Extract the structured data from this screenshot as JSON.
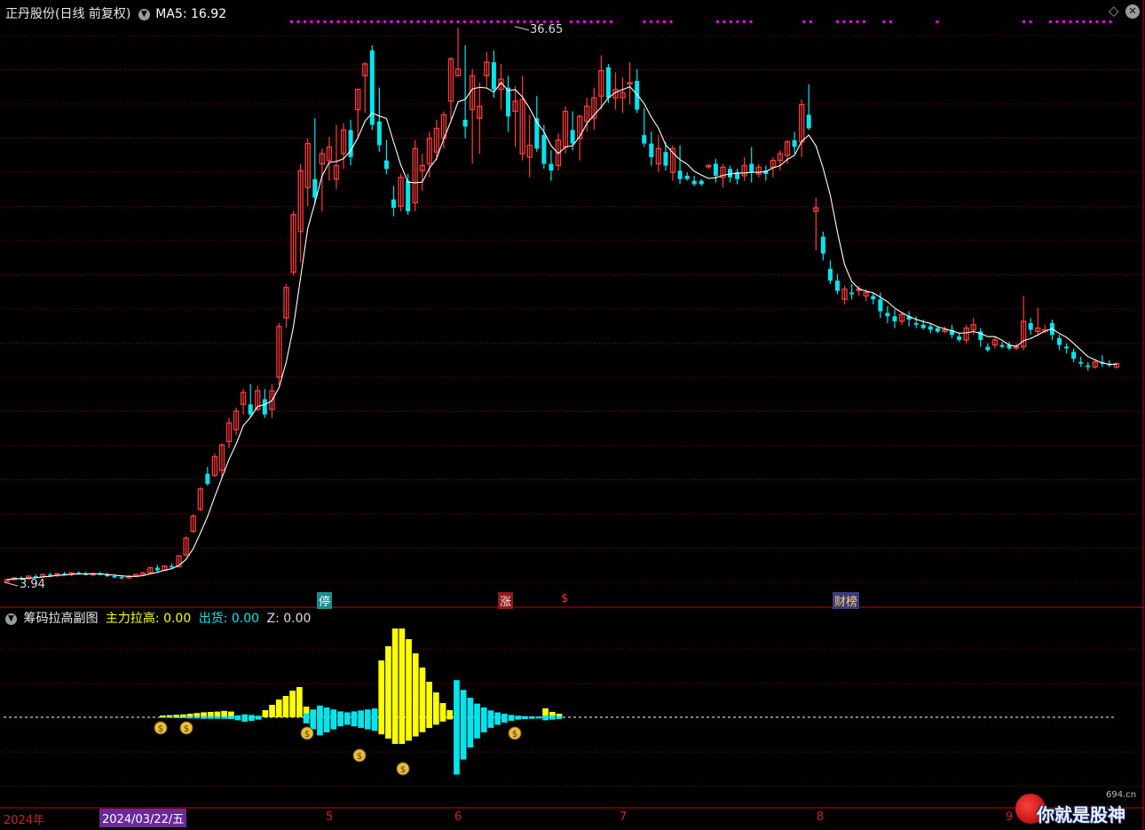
{
  "main_header": {
    "title": "正丹股份(日线 前复权)",
    "ma_label": "MA5:",
    "ma_value": "16.92"
  },
  "sub_header": {
    "title": "筹码拉高副图",
    "zl_label": "主力拉高:",
    "zl_value": "0.00",
    "ch_label": "出货:",
    "ch_value": "0.00",
    "z_label": "Z:",
    "z_value": "0.00"
  },
  "markers": [
    {
      "text": "停",
      "color": "#1c8c8c",
      "fg": "#e0ffff"
    },
    {
      "text": "涨",
      "color": "#8c1c1c",
      "fg": "#ffe0e0"
    },
    {
      "text": "$",
      "color": "#000000",
      "fg": "#ff3030"
    },
    {
      "text": "财榜",
      "color": "#3c3c7c",
      "fg": "#ffd070"
    }
  ],
  "time_axis": {
    "year_label": "2024年",
    "cursor_date": "2024/03/22/五",
    "months": [
      "5",
      "6",
      "7",
      "8",
      "9"
    ]
  },
  "watermark": {
    "text": "你就是股神",
    "site": "694.cn"
  },
  "colors": {
    "up": "#ff3b3b",
    "down": "#00e5ee",
    "ma": "#ffffff",
    "zhuli": "#ffff00",
    "chuhuo": "#00e5ee",
    "grid": "#6b0000",
    "magenta": "#ff00ff"
  },
  "chart_data": {
    "type": "candlestick",
    "price_annotations": {
      "high": "36.65",
      "low": "3.94"
    },
    "candles": [
      [
        3.94,
        4.1,
        3.9,
        4.05
      ],
      [
        4.05,
        4.2,
        4.0,
        4.15
      ],
      [
        4.15,
        4.25,
        4.05,
        4.1
      ],
      [
        4.1,
        4.3,
        4.05,
        4.25
      ],
      [
        4.25,
        4.35,
        4.15,
        4.2
      ],
      [
        4.2,
        4.4,
        4.15,
        4.35
      ],
      [
        4.35,
        4.45,
        4.25,
        4.3
      ],
      [
        4.3,
        4.45,
        4.2,
        4.4
      ],
      [
        4.4,
        4.5,
        4.3,
        4.35
      ],
      [
        4.35,
        4.5,
        4.25,
        4.45
      ],
      [
        4.45,
        4.55,
        4.35,
        4.4
      ],
      [
        4.4,
        4.5,
        4.3,
        4.35
      ],
      [
        4.35,
        4.45,
        4.25,
        4.4
      ],
      [
        4.4,
        4.5,
        4.3,
        4.35
      ],
      [
        4.35,
        4.45,
        4.2,
        4.25
      ],
      [
        4.25,
        4.35,
        4.15,
        4.2
      ],
      [
        4.2,
        4.3,
        4.1,
        4.15
      ],
      [
        4.15,
        4.3,
        4.1,
        4.25
      ],
      [
        4.25,
        4.4,
        4.2,
        4.35
      ],
      [
        4.35,
        4.5,
        4.3,
        4.45
      ],
      [
        4.45,
        4.8,
        4.4,
        4.75
      ],
      [
        4.75,
        4.9,
        4.5,
        4.6
      ],
      [
        4.6,
        4.9,
        4.55,
        4.85
      ],
      [
        4.85,
        5.0,
        4.7,
        4.8
      ],
      [
        4.8,
        5.5,
        4.8,
        5.45
      ],
      [
        5.5,
        6.6,
        5.4,
        6.5
      ],
      [
        6.9,
        7.9,
        6.8,
        7.8
      ],
      [
        8.2,
        9.5,
        8.1,
        9.4
      ],
      [
        10.3,
        10.7,
        9.6,
        9.7
      ],
      [
        10.2,
        11.5,
        10.1,
        11.3
      ],
      [
        10.5,
        12.1,
        10.1,
        12.0
      ],
      [
        12.2,
        13.6,
        11.8,
        13.3
      ],
      [
        12.9,
        14.2,
        12.6,
        14.0
      ],
      [
        14.4,
        15.3,
        13.8,
        15.1
      ],
      [
        14.4,
        15.6,
        13.6,
        13.8
      ],
      [
        14.1,
        15.5,
        14.0,
        15.2
      ],
      [
        14.7,
        15.3,
        13.6,
        13.8
      ],
      [
        14.1,
        15.6,
        13.6,
        15.2
      ],
      [
        16.0,
        19.2,
        15.5,
        19.0
      ],
      [
        19.5,
        21.5,
        18.9,
        21.3
      ],
      [
        22.2,
        25.8,
        22.0,
        25.6
      ],
      [
        24.6,
        28.6,
        22.8,
        28.2
      ],
      [
        27.2,
        30.1,
        26.1,
        29.8
      ],
      [
        27.7,
        31.3,
        26.2,
        26.6
      ],
      [
        28.6,
        29.5,
        25.8,
        29.2
      ],
      [
        28.8,
        30.2,
        27.6,
        29.6
      ],
      [
        27.7,
        30.9,
        27.1,
        28.5
      ],
      [
        29.2,
        31.0,
        28.3,
        30.6
      ],
      [
        30.6,
        31.2,
        28.5,
        29.0
      ],
      [
        31.8,
        33.0,
        30.2,
        33.0
      ],
      [
        33.8,
        34.6,
        31.6,
        34.5
      ],
      [
        35.3,
        35.6,
        30.6,
        30.9
      ],
      [
        31.1,
        33.1,
        29.3,
        29.7
      ],
      [
        28.8,
        30.0,
        28.0,
        28.3
      ],
      [
        26.5,
        27.3,
        25.5,
        26.0
      ],
      [
        26.1,
        28.0,
        25.8,
        27.8
      ],
      [
        27.6,
        28.0,
        25.6,
        25.8
      ],
      [
        26.3,
        30.0,
        25.8,
        29.5
      ],
      [
        28.2,
        29.2,
        27.0,
        28.5
      ],
      [
        28.6,
        30.5,
        27.8,
        30.1
      ],
      [
        29.3,
        31.2,
        28.8,
        30.7
      ],
      [
        30.1,
        31.7,
        29.5,
        31.5
      ],
      [
        32.3,
        34.9,
        31.2,
        34.8
      ],
      [
        33.8,
        36.65,
        33.8,
        34.2
      ],
      [
        31.2,
        35.6,
        30.1,
        30.8
      ],
      [
        31.8,
        34.2,
        28.6,
        33.8
      ],
      [
        31.3,
        33.4,
        29.2,
        32.0
      ],
      [
        33.8,
        35.2,
        33.1,
        34.6
      ],
      [
        34.6,
        35.3,
        32.5,
        33.0
      ],
      [
        33.0,
        34.5,
        31.8,
        33.6
      ],
      [
        33.1,
        33.8,
        30.5,
        31.4
      ],
      [
        31.7,
        33.2,
        29.6,
        32.3
      ],
      [
        29.2,
        33.8,
        28.8,
        32.4
      ],
      [
        29.0,
        31.5,
        27.8,
        29.7
      ],
      [
        31.3,
        32.6,
        29.3,
        29.5
      ],
      [
        30.3,
        30.9,
        28.3,
        28.6
      ],
      [
        28.6,
        29.4,
        27.6,
        28.2
      ],
      [
        28.5,
        30.4,
        28.2,
        30.0
      ],
      [
        29.6,
        32.0,
        29.2,
        31.7
      ],
      [
        30.6,
        31.7,
        29.4,
        29.8
      ],
      [
        30.1,
        31.5,
        28.8,
        31.4
      ],
      [
        31.1,
        32.5,
        30.5,
        32.0
      ],
      [
        31.3,
        33.1,
        30.6,
        32.5
      ],
      [
        32.6,
        35.0,
        31.8,
        34.1
      ],
      [
        34.3,
        34.5,
        32.2,
        32.5
      ],
      [
        32.5,
        34.0,
        31.8,
        33.0
      ],
      [
        32.5,
        33.7,
        31.6,
        32.8
      ],
      [
        33.4,
        34.6,
        32.1,
        33.4
      ],
      [
        33.5,
        34.2,
        31.6,
        31.8
      ],
      [
        30.3,
        31.9,
        29.6,
        29.8
      ],
      [
        29.8,
        30.5,
        28.5,
        29.0
      ],
      [
        28.6,
        30.3,
        28.1,
        29.5
      ],
      [
        29.3,
        29.9,
        28.2,
        28.5
      ],
      [
        28.1,
        29.7,
        27.6,
        29.5
      ],
      [
        28.2,
        29.7,
        27.4,
        27.7
      ],
      [
        27.9,
        28.1,
        27.6,
        27.7
      ],
      [
        27.6,
        27.9,
        27.3,
        27.4
      ],
      [
        27.6,
        27.7,
        27.3,
        27.4
      ],
      [
        28.5,
        28.6,
        28.3,
        28.5
      ],
      [
        28.6,
        28.9,
        27.5,
        27.9
      ],
      [
        27.8,
        28.6,
        27.2,
        28.4
      ],
      [
        28.3,
        28.5,
        27.5,
        27.8
      ],
      [
        28.1,
        28.3,
        27.4,
        27.7
      ],
      [
        27.9,
        29.0,
        27.6,
        28.5
      ],
      [
        28.6,
        29.6,
        27.5,
        28.1
      ],
      [
        28.0,
        28.6,
        27.8,
        28.4
      ],
      [
        28.2,
        28.5,
        27.6,
        28.0
      ],
      [
        28.4,
        29.0,
        27.8,
        28.8
      ],
      [
        28.8,
        29.4,
        28.2,
        29.2
      ],
      [
        29.1,
        30.0,
        28.6,
        29.9
      ],
      [
        30.0,
        30.5,
        29.2,
        29.6
      ],
      [
        29.9,
        32.4,
        29.0,
        32.1
      ],
      [
        31.5,
        33.3,
        30.6,
        30.7
      ],
      [
        25.8,
        26.6,
        23.5,
        26.0
      ],
      [
        24.3,
        24.6,
        22.9,
        23.3
      ],
      [
        22.4,
        22.9,
        21.5,
        21.7
      ],
      [
        21.7,
        22.1,
        20.9,
        21.1
      ],
      [
        20.6,
        21.4,
        20.3,
        21.2
      ],
      [
        21.0,
        21.5,
        20.6,
        20.9
      ],
      [
        21.2,
        21.4,
        20.8,
        21.2
      ],
      [
        20.8,
        21.2,
        20.5,
        21.0
      ],
      [
        20.8,
        21.0,
        20.3,
        20.6
      ],
      [
        20.6,
        21.0,
        19.5,
        19.9
      ],
      [
        19.8,
        20.2,
        19.2,
        19.6
      ],
      [
        19.6,
        20.0,
        18.9,
        19.3
      ],
      [
        19.3,
        19.8,
        19.1,
        19.7
      ],
      [
        19.6,
        19.9,
        19.0,
        19.4
      ],
      [
        19.2,
        19.6,
        18.9,
        19.1
      ],
      [
        19.1,
        19.4,
        18.8,
        18.9
      ],
      [
        19.0,
        19.2,
        18.6,
        18.8
      ],
      [
        18.9,
        19.0,
        18.6,
        18.7
      ],
      [
        18.7,
        19.0,
        18.6,
        18.8
      ],
      [
        18.8,
        19.1,
        18.3,
        18.5
      ],
      [
        18.4,
        18.6,
        18.1,
        18.2
      ],
      [
        18.2,
        19.1,
        18.0,
        18.9
      ],
      [
        18.8,
        19.5,
        18.5,
        19.1
      ],
      [
        18.7,
        18.9,
        17.8,
        18.2
      ],
      [
        17.8,
        18.0,
        17.5,
        17.6
      ],
      [
        17.9,
        18.4,
        17.7,
        18.2
      ],
      [
        17.9,
        18.1,
        17.7,
        17.8
      ],
      [
        17.9,
        18.1,
        17.6,
        17.7
      ],
      [
        17.8,
        18.0,
        17.6,
        17.8
      ],
      [
        17.8,
        20.8,
        17.6,
        19.3
      ],
      [
        19.2,
        19.5,
        18.5,
        18.8
      ],
      [
        18.7,
        20.1,
        18.4,
        18.9
      ],
      [
        18.8,
        19.1,
        18.6,
        18.8
      ],
      [
        19.2,
        19.4,
        18.2,
        18.5
      ],
      [
        18.3,
        18.5,
        17.6,
        17.9
      ],
      [
        17.8,
        18.0,
        17.4,
        17.7
      ],
      [
        17.5,
        17.7,
        16.9,
        17.1
      ],
      [
        16.9,
        17.2,
        16.6,
        16.8
      ],
      [
        16.7,
        16.9,
        16.4,
        16.6
      ],
      [
        16.6,
        17.1,
        16.5,
        16.9
      ],
      [
        16.9,
        17.3,
        16.6,
        16.8
      ],
      [
        16.8,
        17.0,
        16.6,
        16.7
      ],
      [
        16.6,
        16.9,
        16.5,
        16.8
      ]
    ],
    "ma5": "computed from candles",
    "zhuli_bars": [
      0.05,
      0.06,
      0.07,
      0.08,
      0.1,
      0.12,
      0.14,
      0.15,
      0.16,
      0.18,
      0.16,
      0.0,
      0.0,
      0.0,
      0.0,
      0.2,
      0.35,
      0.5,
      0.6,
      0.75,
      0.85,
      0.3,
      0.2,
      0.15,
      0.1,
      0.08,
      0.05,
      0.0,
      0.0,
      0.0,
      0.0,
      0.0,
      1.6,
      2.0,
      2.5,
      2.5,
      2.2,
      1.8,
      1.4,
      1.0,
      0.7,
      0.4,
      0.2,
      0.0,
      0.0,
      0.0,
      0.0,
      0.0,
      0.0,
      0.0,
      0.0,
      0.0,
      0.0,
      0.0,
      0.0,
      0.0,
      0.25,
      0.15,
      0.1
    ],
    "chuhuo_bars": [
      0.02,
      0.02,
      0.03,
      0.03,
      0.04,
      0.04,
      0.05,
      0.05,
      0.05,
      0.05,
      0.06,
      0.1,
      0.15,
      0.12,
      0.08,
      0.0,
      0.0,
      0.0,
      0.0,
      0.0,
      0.0,
      0.2,
      0.4,
      0.6,
      0.5,
      0.4,
      0.3,
      0.25,
      0.3,
      0.35,
      0.4,
      0.45,
      0.0,
      0.0,
      0.0,
      0.0,
      0.0,
      0.0,
      0.0,
      0.0,
      0.0,
      0.0,
      0.0,
      1.9,
      1.4,
      1.0,
      0.7,
      0.5,
      0.35,
      0.25,
      0.18,
      0.12,
      0.08,
      0.06,
      0.05,
      0.04,
      0.1,
      0.08,
      0.06
    ]
  }
}
